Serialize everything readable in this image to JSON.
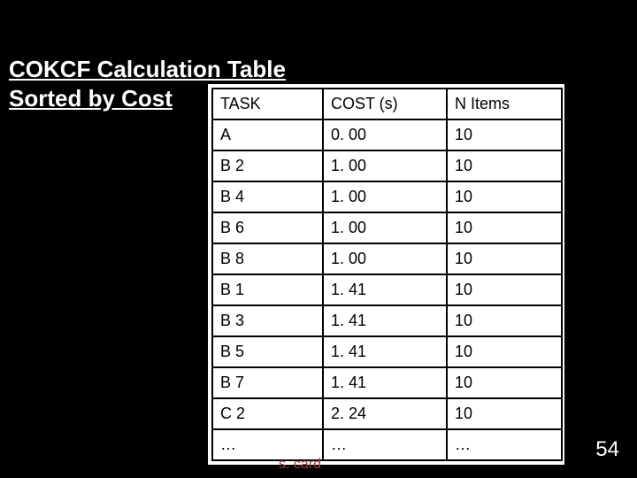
{
  "title_line1": "COKCF Calculation Table",
  "title_line2": "Sorted by Cost",
  "headers": {
    "task": "TASK",
    "cost": "COST (s)",
    "nitems": "N Items"
  },
  "rows": [
    {
      "task": "A",
      "cost": "0. 00",
      "nitems": "10"
    },
    {
      "task": "B 2",
      "cost": "1. 00",
      "nitems": "10"
    },
    {
      "task": "B 4",
      "cost": "1. 00",
      "nitems": "10"
    },
    {
      "task": "B 6",
      "cost": "1. 00",
      "nitems": "10"
    },
    {
      "task": "B 8",
      "cost": "1. 00",
      "nitems": "10"
    },
    {
      "task": "B 1",
      "cost": "1. 41",
      "nitems": "10"
    },
    {
      "task": "B 3",
      "cost": "1. 41",
      "nitems": "10"
    },
    {
      "task": "B 5",
      "cost": "1. 41",
      "nitems": "10"
    },
    {
      "task": "B 7",
      "cost": "1. 41",
      "nitems": "10"
    },
    {
      "task": "C 2",
      "cost": "2. 24",
      "nitems": "10"
    },
    {
      "task": "…",
      "cost": "…",
      "nitems": "…"
    }
  ],
  "footer_author": "s. card",
  "page_number": "54"
}
